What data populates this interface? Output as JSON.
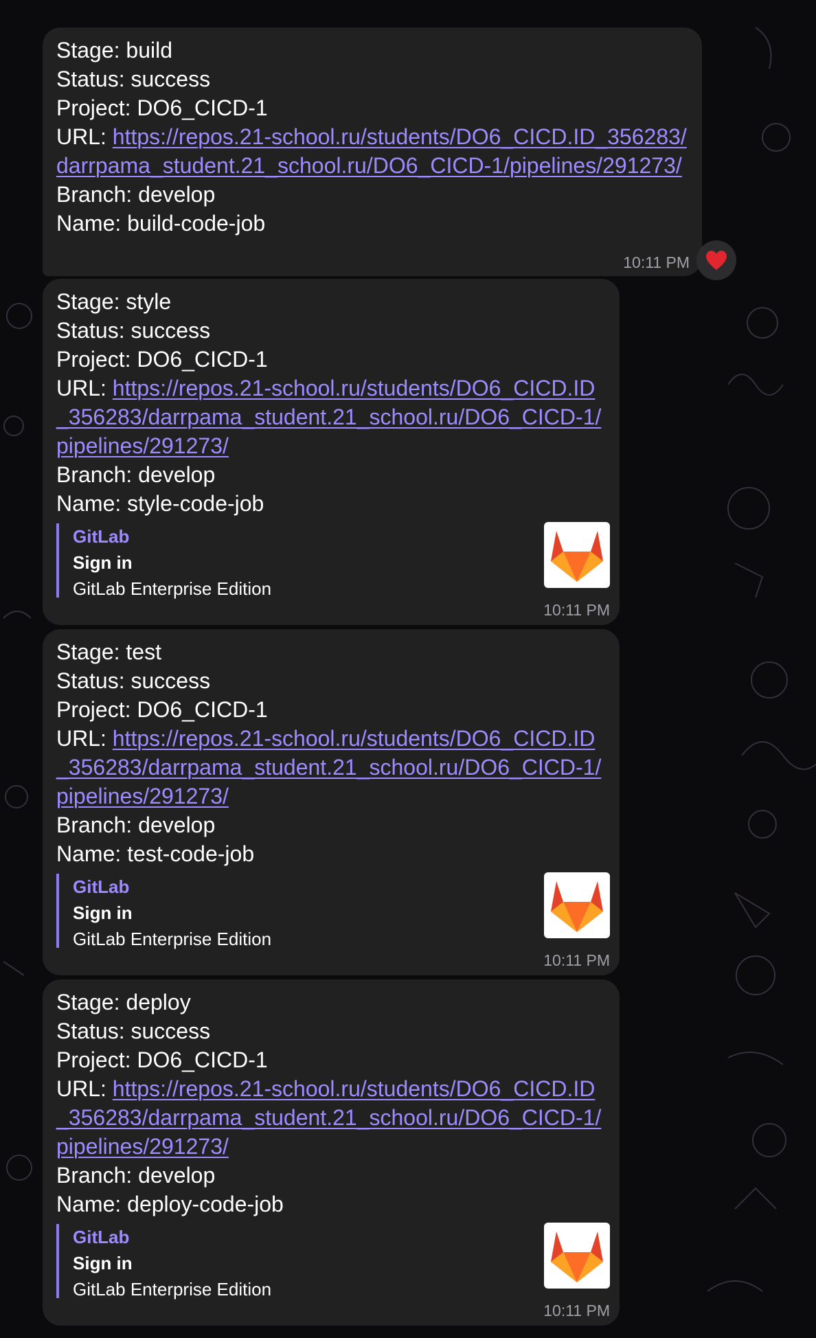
{
  "messages": [
    {
      "stage_line": "Stage: build",
      "status_line": "Status: success",
      "project_line": "Project: DO6_CICD-1",
      "url_prefix": "URL: ",
      "url": "https://repos.21-school.ru/students/DO6_CICD.ID_356283/darrpama_student.21_school.ru/DO6_CICD-1/pipelines/291273/",
      "branch_line": "Branch: develop",
      "name_line": "Name: build-code-job",
      "time": "10:11 PM",
      "reaction": "heart-icon"
    },
    {
      "stage_line": "Stage: style",
      "status_line": "Status: success",
      "project_line": "Project: DO6_CICD-1",
      "url_prefix": "URL: ",
      "url": "https://repos.21-school.ru/students/DO6_CICD.ID_356283/darrpama_student.21_school.ru/DO6_CICD-1/pipelines/291273/",
      "branch_line": "Branch: develop",
      "name_line": "Name: style-code-job",
      "preview": {
        "site": "GitLab",
        "title": "Sign in",
        "description": "GitLab Enterprise Edition",
        "icon": "gitlab-logo-icon"
      },
      "time": "10:11 PM"
    },
    {
      "stage_line": "Stage: test",
      "status_line": "Status: success",
      "project_line": "Project: DO6_CICD-1",
      "url_prefix": "URL: ",
      "url": "https://repos.21-school.ru/students/DO6_CICD.ID_356283/darrpama_student.21_school.ru/DO6_CICD-1/pipelines/291273/",
      "branch_line": "Branch: develop",
      "name_line": "Name: test-code-job",
      "preview": {
        "site": "GitLab",
        "title": "Sign in",
        "description": "GitLab Enterprise Edition",
        "icon": "gitlab-logo-icon"
      },
      "time": "10:11 PM"
    },
    {
      "stage_line": "Stage: deploy",
      "status_line": "Status: success",
      "project_line": "Project: DO6_CICD-1",
      "url_prefix": "URL: ",
      "url": "https://repos.21-school.ru/students/DO6_CICD.ID_356283/darrpama_student.21_school.ru/DO6_CICD-1/pipelines/291273/",
      "branch_line": "Branch: develop",
      "name_line": "Name: deploy-code-job",
      "preview": {
        "site": "GitLab",
        "title": "Sign in",
        "description": "GitLab Enterprise Edition",
        "icon": "gitlab-logo-icon"
      },
      "time": "10:11 PM"
    }
  ],
  "colors": {
    "background": "#0b0b0d",
    "bubble": "#212121",
    "link": "#9d8cff",
    "preview_bar": "#8b7cf6",
    "timestamp": "#a0a0a8",
    "reaction": "#e0262f"
  }
}
